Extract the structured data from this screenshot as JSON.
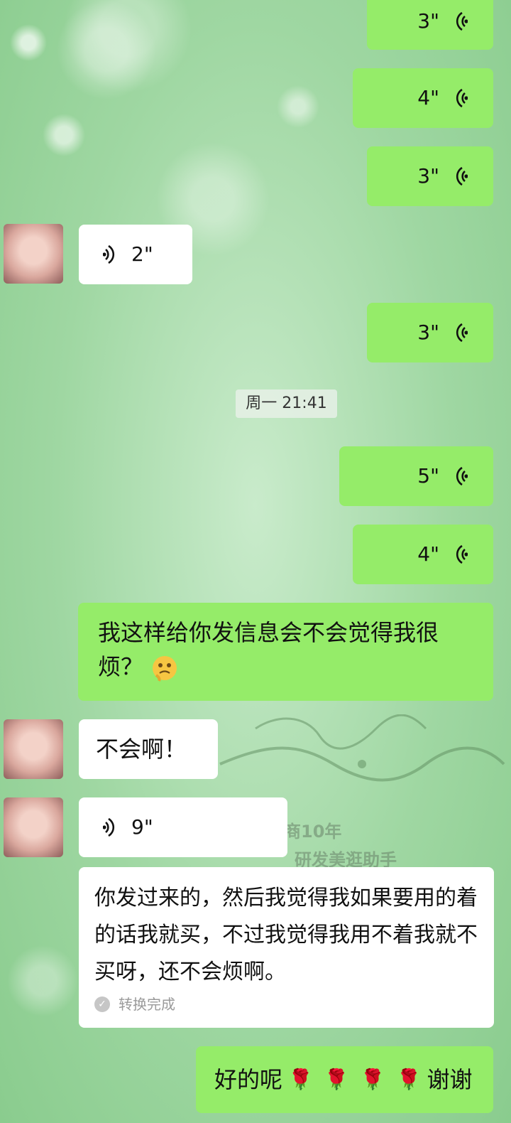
{
  "messages": {
    "voice_1": "3\"",
    "voice_2": "4\"",
    "voice_3": "3\"",
    "voice_recv_1": "2\"",
    "voice_4": "3\"",
    "timestamp": "周一 21:41",
    "voice_5": "5\"",
    "voice_6": "4\"",
    "text_sent_1": "我这样给你发信息会不会觉得我很烦？",
    "text_recv_1": "不会啊！",
    "voice_recv_2": "9\"",
    "transcript": "你发过来的，然后我觉得我如果要用的着的话我就买，不过我觉得我用不着我就不买呀，还不会烦啊。",
    "converted_label": "转换完成",
    "text_sent_2_a": "好的呢",
    "text_sent_2_b": "谢谢"
  },
  "background": {
    "text_1": "商10年",
    "text_2": "研发美逛助手"
  },
  "colors": {
    "sent_bubble": "#95ec69",
    "recv_bubble": "#ffffff"
  },
  "icons": [
    "voice-wave-icon",
    "avatar",
    "flushed-emoji-icon",
    "rose-icon",
    "check-icon"
  ]
}
